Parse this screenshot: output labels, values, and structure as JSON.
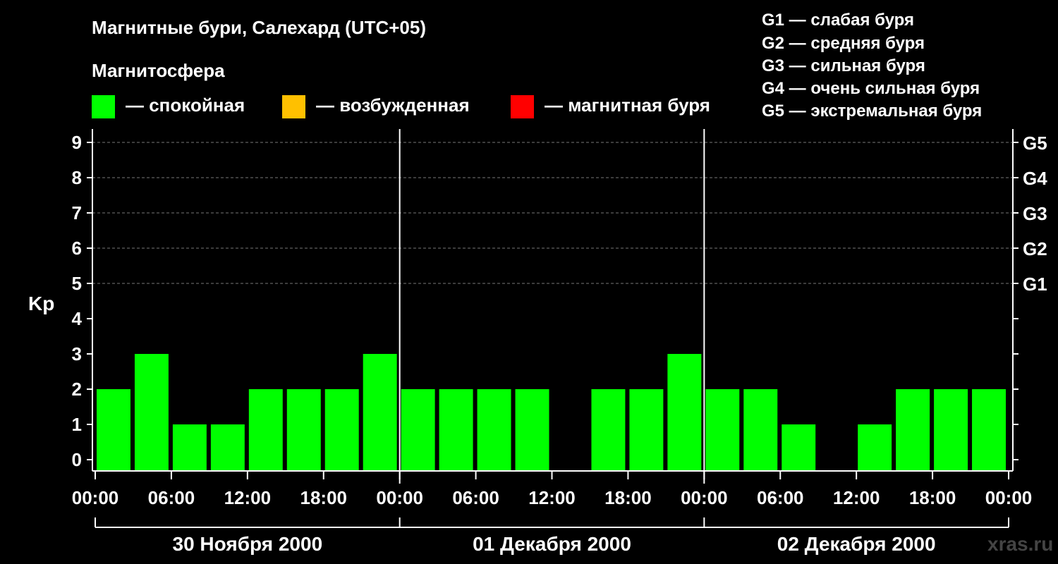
{
  "title": "Магнитные бури, Салехард (UTC+05)",
  "subtitle": "Магнитосфера",
  "legend": [
    {
      "label": "— спокойная",
      "color": "#00ff00"
    },
    {
      "label": "— возбужденная",
      "color": "#ffc000"
    },
    {
      "label": "— магнитная буря",
      "color": "#ff0000"
    }
  ],
  "g_legend": [
    "G1 — слабая буря",
    "G2 — средняя буря",
    "G3 — сильная буря",
    "G4 — очень сильная буря",
    "G5 — экстремальная буря"
  ],
  "watermark": "xras.ru",
  "chart_data": {
    "type": "bar",
    "ylabel": "Kp",
    "ylim": [
      0,
      9
    ],
    "yticks": [
      "0",
      "1",
      "2",
      "3",
      "4",
      "5",
      "6",
      "7",
      "8",
      "9"
    ],
    "g_ticks": [
      {
        "level": 5,
        "label": "G1"
      },
      {
        "level": 6,
        "label": "G2"
      },
      {
        "level": 7,
        "label": "G3"
      },
      {
        "level": 8,
        "label": "G4"
      },
      {
        "level": 9,
        "label": "G5"
      }
    ],
    "xticks": [
      "00:00",
      "06:00",
      "12:00",
      "18:00",
      "00:00",
      "06:00",
      "12:00",
      "18:00",
      "00:00",
      "06:00",
      "12:00",
      "18:00",
      "00:00"
    ],
    "dates": [
      "30 Ноября 2000",
      "01 Декабря 2000",
      "02 Декабря 2000"
    ],
    "grid": true,
    "bar_hours": 3,
    "values": [
      2,
      3,
      1,
      1,
      2,
      2,
      2,
      3,
      2,
      2,
      2,
      2,
      0,
      2,
      2,
      3,
      2,
      2,
      1,
      0,
      1,
      2,
      2,
      2
    ],
    "colors": {
      "quiet": "#00ff00",
      "active": "#ffc000",
      "storm": "#ff0000"
    }
  }
}
